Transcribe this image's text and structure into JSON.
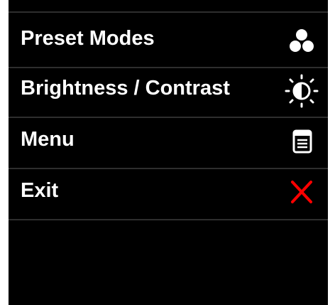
{
  "menu": {
    "items": [
      {
        "label": "Preset Modes",
        "icon": "preset-modes-icon"
      },
      {
        "label": "Brightness / Contrast",
        "icon": "brightness-contrast-icon"
      },
      {
        "label": "Menu",
        "icon": "menu-icon"
      },
      {
        "label": "Exit",
        "icon": "close-icon"
      }
    ]
  },
  "colors": {
    "background": "#000000",
    "text": "#ffffff",
    "divider": "#2e2e2e",
    "exit_accent": "#ff0000"
  }
}
